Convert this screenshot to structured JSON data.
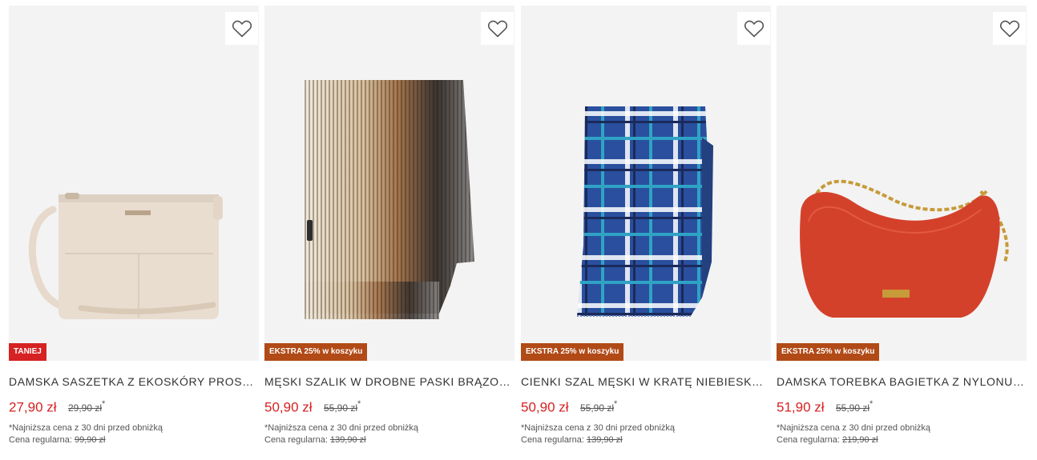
{
  "colors": {
    "price_red": "#d62222",
    "badge_red": "#d62222",
    "badge_brown": "#b14a16",
    "image_bg": "#f3f3f3"
  },
  "products": [
    {
      "title": "DAMSKA SASZETKA Z EKOSKÓRY PROSTA B...",
      "price": "27,90 zł",
      "old_price": "29,90 zł",
      "star": "*",
      "badge": "TANIEJ",
      "note": "*Najniższa cena z 30 dni przed obniżką",
      "regular_label": "Cena regularna:",
      "regular_price": "99,90 zł",
      "favorite_icon": "heart-outline-icon"
    },
    {
      "title": "MĘSKI SZALIK W DROBNE PASKI BRĄZOWO-...",
      "price": "50,90 zł",
      "old_price": "55,90 zł",
      "star": "*",
      "badge": "EKSTRA 25% w koszyku",
      "note": "*Najniższa cena z 30 dni przed obniżką",
      "regular_label": "Cena regularna:",
      "regular_price": "139,90 zł",
      "favorite_icon": "heart-outline-icon"
    },
    {
      "title": "CIENKI SZAL MĘSKI W KRATĘ NIEBIESKO - C...",
      "price": "50,90 zł",
      "old_price": "55,90 zł",
      "star": "*",
      "badge": "EKSTRA 25% w koszyku",
      "note": "*Najniższa cena z 30 dni przed obniżką",
      "regular_label": "Cena regularna:",
      "regular_price": "139,90 zł",
      "favorite_icon": "heart-outline-icon"
    },
    {
      "title": "DAMSKA TOREBKA BAGIETKA Z NYLONU NA...",
      "price": "51,90 zł",
      "old_price": "55,90 zł",
      "star": "*",
      "badge": "EKSTRA 25% w koszyku",
      "note": "*Najniższa cena z 30 dni przed obniżką",
      "regular_label": "Cena regularna:",
      "regular_price": "219,90 zł",
      "favorite_icon": "heart-outline-icon"
    }
  ]
}
